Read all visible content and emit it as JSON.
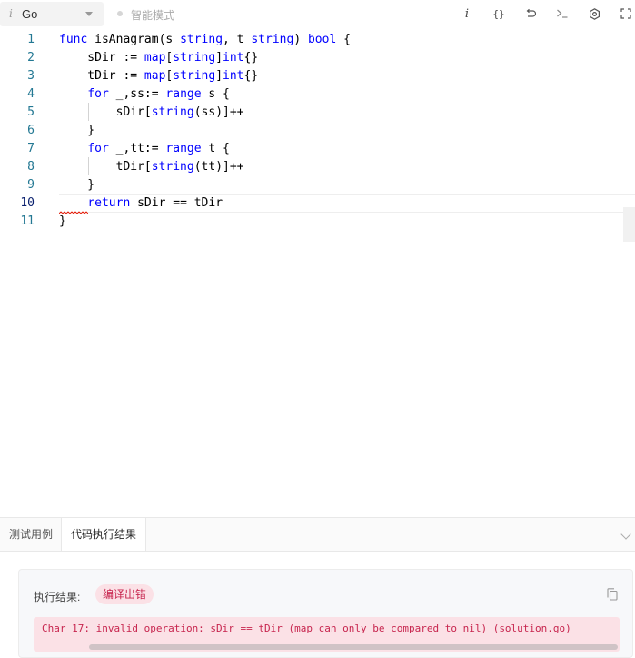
{
  "toolbar": {
    "language_icon": "i",
    "language": "Go",
    "mode_label": "智能模式",
    "icons": [
      "info-icon",
      "braces-icon",
      "reset-icon",
      "terminal-icon",
      "settings-icon",
      "fullscreen-icon"
    ]
  },
  "editor": {
    "line_numbers": [
      "1",
      "2",
      "3",
      "4",
      "5",
      "6",
      "7",
      "8",
      "9",
      "10",
      "11"
    ],
    "active_line": 10,
    "lines": [
      "func isAnagram(s string, t string) bool {",
      "    sDir := map[string]int{}",
      "    tDir := map[string]int{}",
      "    for _,ss:= range s {",
      "        sDir[string(ss)]++",
      "    }",
      "    for _,tt:= range t {",
      "        tDir[string(tt)]++",
      "    }",
      "    return sDir == tDir",
      "}"
    ]
  },
  "bottom_panel": {
    "tabs": [
      "测试用例",
      "代码执行结果"
    ],
    "active_tab": 1,
    "result_label": "执行结果:",
    "status": "编译出错",
    "error_message": "Char 17: invalid operation: sDir == tDir (map can only be compared to nil) (solution.go)"
  },
  "colors": {
    "keyword": "#0000ff",
    "line_number": "#237893",
    "error_text": "#c7254e",
    "error_bg": "#fbe1e6"
  }
}
